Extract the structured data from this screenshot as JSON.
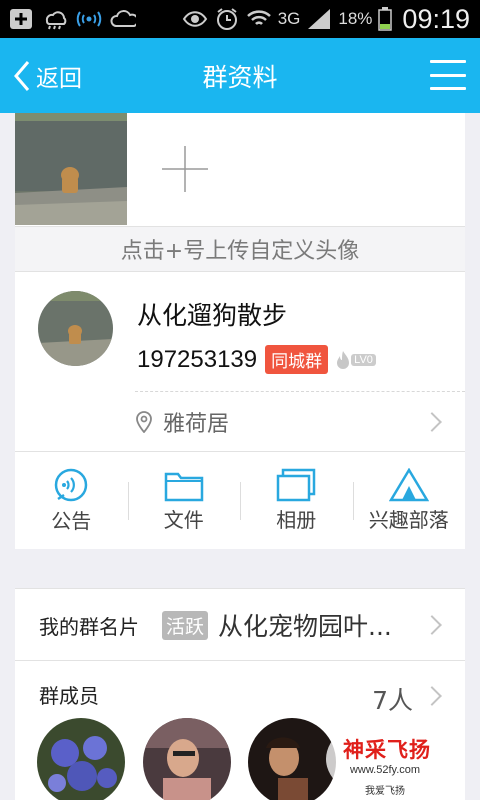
{
  "status_bar": {
    "network": "3G",
    "battery": "18%",
    "time": "09:19",
    "icons": [
      "add-icon",
      "weather-icon",
      "signal-icon",
      "cloud-icon",
      "eye-icon",
      "alarm-icon",
      "wifi-icon",
      "cell-signal-icon",
      "battery-icon"
    ]
  },
  "nav": {
    "back_label": "返回",
    "title": "群资料"
  },
  "header": {
    "upload_hint": "点击+号上传自定义头像"
  },
  "group": {
    "name": "从化遛狗散步",
    "id": "197253139",
    "city_tag": "同城群",
    "level": "LV0",
    "location": "雅荷居"
  },
  "actions": [
    {
      "label": "公告",
      "icon": "announcement-icon"
    },
    {
      "label": "文件",
      "icon": "folder-icon"
    },
    {
      "label": "相册",
      "icon": "album-icon"
    },
    {
      "label": "兴趣部落",
      "icon": "tribe-tent-icon"
    }
  ],
  "card": {
    "label": "我的群名片",
    "active_tag": "活跃",
    "value": "从化宠物园叶..."
  },
  "members": {
    "label": "群成员",
    "count": "7人"
  },
  "watermark": {
    "title": "神采飞扬",
    "url": "www.52fy.com",
    "sub": "我爱飞扬"
  },
  "colors": {
    "nav_bg": "#1ab6f0",
    "city_tag": "#f0553e",
    "icon_blue": "#29a8df"
  }
}
